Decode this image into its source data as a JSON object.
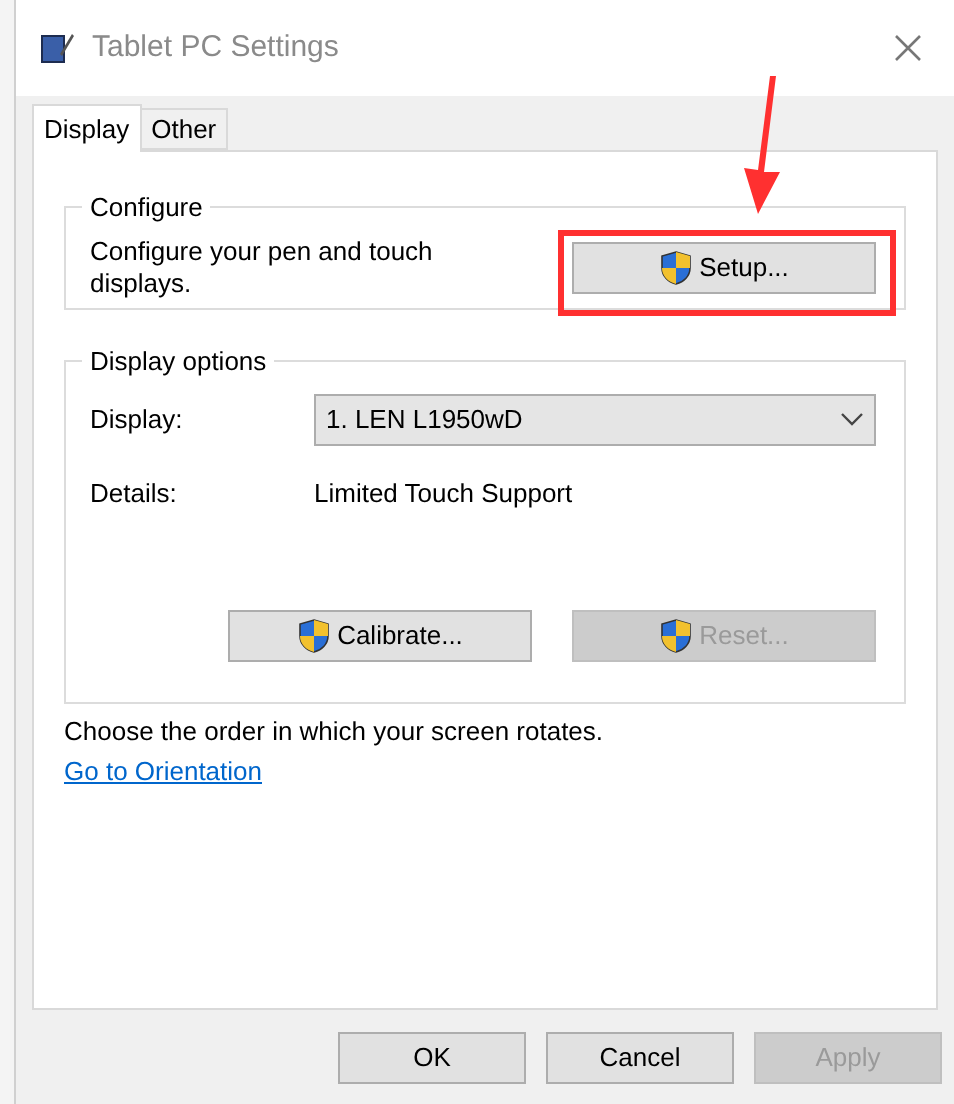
{
  "window": {
    "title": "Tablet PC Settings"
  },
  "tabs": [
    {
      "label": "Display",
      "selected": true
    },
    {
      "label": "Other",
      "selected": false
    }
  ],
  "configure": {
    "title": "Configure",
    "text": "Configure your pen and touch displays.",
    "button": {
      "label": "Setup...",
      "disabled": false,
      "highlighted": true
    }
  },
  "display_options": {
    "title": "Display options",
    "display_label": "Display:",
    "display_value": "1. LEN L1950wD",
    "details_label": "Details:",
    "details_value": "Limited Touch Support",
    "buttons": [
      {
        "label": "Calibrate...",
        "disabled": false
      },
      {
        "label": "Reset...",
        "disabled": true
      }
    ]
  },
  "orientation": {
    "text": "Choose the order in which your screen rotates.",
    "link": "Go to Orientation"
  },
  "buttons": [
    {
      "label": "OK",
      "disabled": false
    },
    {
      "label": "Cancel",
      "disabled": false
    },
    {
      "label": "Apply",
      "disabled": true
    }
  ]
}
